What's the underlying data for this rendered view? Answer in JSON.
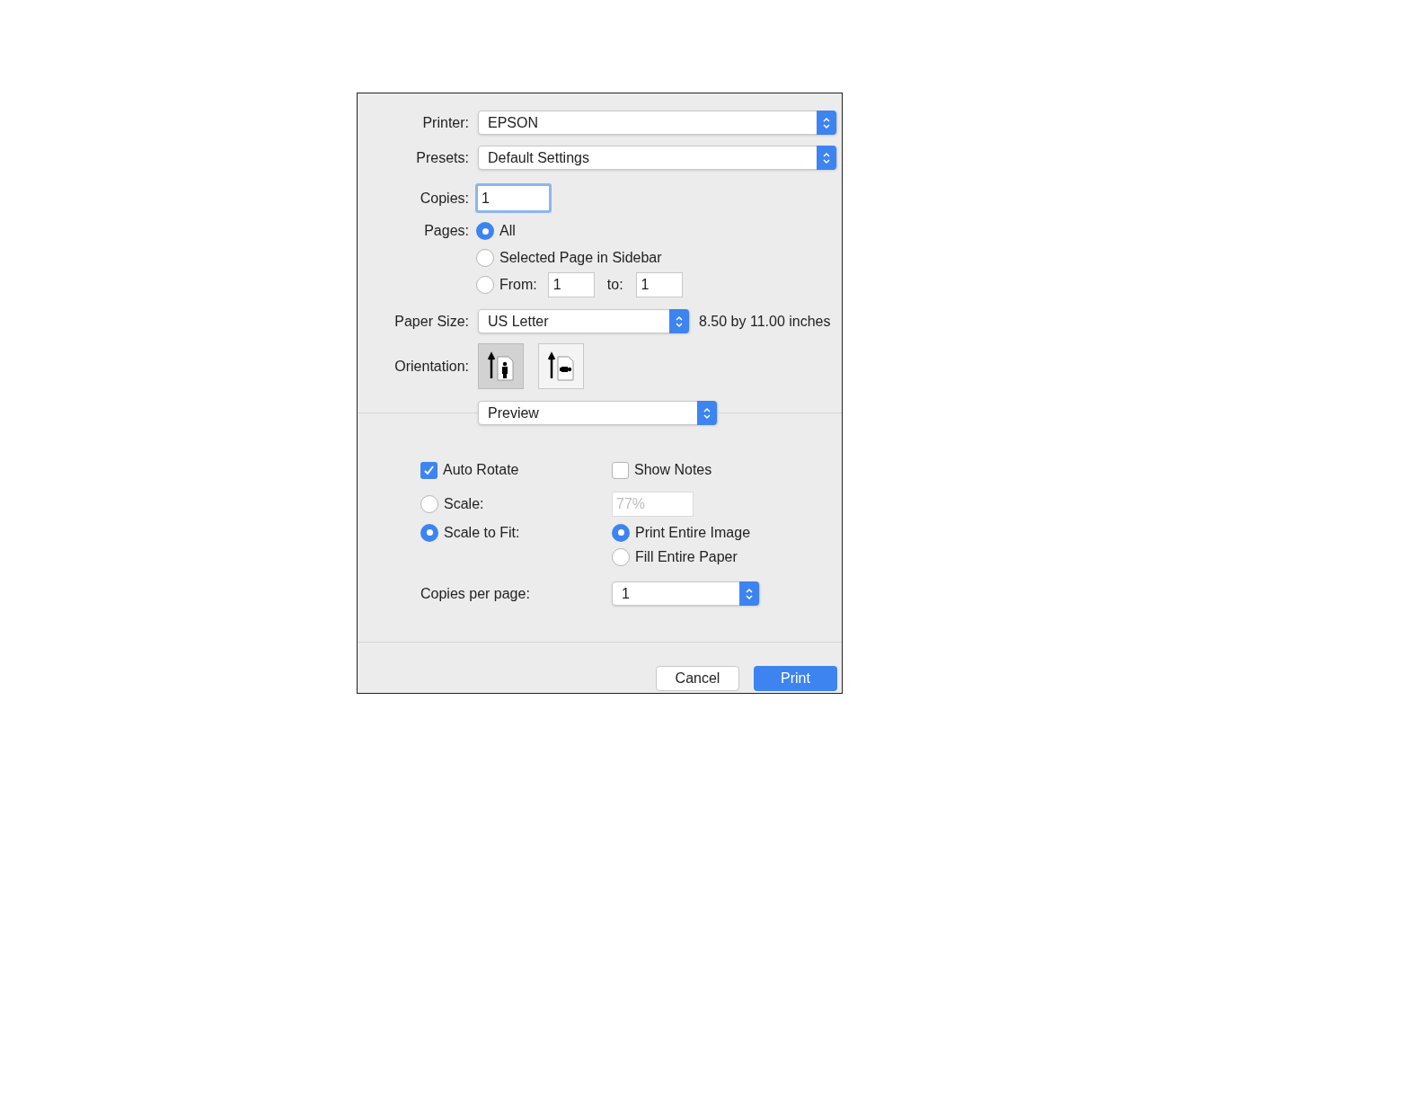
{
  "printer": {
    "label": "Printer:",
    "value": "EPSON"
  },
  "presets": {
    "label": "Presets:",
    "value": "Default Settings"
  },
  "copies": {
    "label": "Copies:",
    "value": "1"
  },
  "pages": {
    "label": "Pages:",
    "options": [
      {
        "kind": "plain",
        "label": "All",
        "selected": true
      },
      {
        "kind": "plain",
        "label": "Selected Page in Sidebar",
        "selected": false
      },
      {
        "kind": "range",
        "label": "From:",
        "from_value": "1",
        "to_label": "to:",
        "to_value": "1",
        "selected": false
      }
    ]
  },
  "paper_size": {
    "label": "Paper Size:",
    "value": "US Letter",
    "dimensions": "8.50 by 11.00 inches"
  },
  "orientation": {
    "label": "Orientation:",
    "options": [
      {
        "kind": "portrait",
        "selected": true
      },
      {
        "kind": "landscape",
        "selected": false
      }
    ]
  },
  "section_popup": {
    "value": "Preview"
  },
  "auto_rotate": {
    "label": "Auto Rotate",
    "checked": true
  },
  "show_notes": {
    "label": "Show Notes",
    "checked": false
  },
  "scale": {
    "label": "Scale:",
    "selected": false,
    "value": "77%"
  },
  "scale_to_fit": {
    "label": "Scale to Fit:",
    "selected": true
  },
  "fit_options": [
    {
      "label": "Print Entire Image",
      "selected": true
    },
    {
      "label": "Fill Entire Paper",
      "selected": false
    }
  ],
  "copies_per_page": {
    "label": "Copies per page:",
    "value": "1"
  },
  "buttons": [
    {
      "kind": "default",
      "label": "Cancel"
    },
    {
      "kind": "primary",
      "label": "Print"
    }
  ]
}
